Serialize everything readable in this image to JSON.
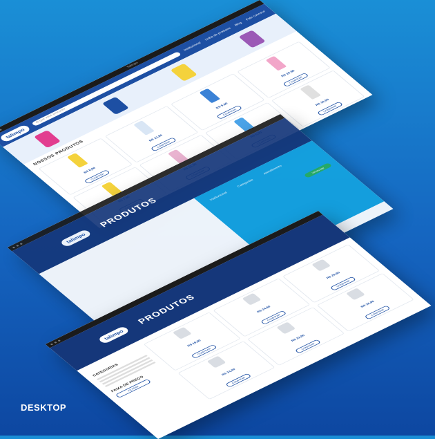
{
  "caption": "DESKTOP",
  "top_page": {
    "browser_title": "Talimpo",
    "logo": "talimpo",
    "search_placeholder": "O que você procura?",
    "nav": [
      "Institucional",
      "Linha de produtos",
      "Blog",
      "Fale conosco"
    ],
    "section_title": "NOSSOS PRODUTOS",
    "products": [
      {
        "price": "R$ 8,90",
        "cta": "COMPRAR",
        "color": "#f4d23c"
      },
      {
        "price": "R$ 12,90",
        "cta": "COMPRAR",
        "color": "#d9e6f5"
      },
      {
        "price": "R$ 9,90",
        "cta": "COMPRAR",
        "color": "#3b82d6"
      },
      {
        "price": "R$ 15,90",
        "cta": "COMPRAR",
        "color": "#f2a6c9"
      },
      {
        "price": "R$ 7,90",
        "cta": "COMPRAR",
        "color": "#f4d23c"
      },
      {
        "price": "R$ 11,90",
        "cta": "COMPRAR",
        "color": "#e9b3d0"
      },
      {
        "price": "R$ 6,90",
        "cta": "COMPRAR",
        "color": "#4aa3e8"
      },
      {
        "price": "R$ 10,90",
        "cta": "COMPRAR",
        "color": "#e0e0e0"
      }
    ],
    "hero_colors": [
      "#e23d8f",
      "#1d4fa3",
      "#f4d23c",
      "#9b59b6"
    ]
  },
  "middle_page": {
    "logo": "talimpo",
    "banner_title": "PRODUTOS",
    "footer_cols": [
      "Institucional",
      "Categorias",
      "Atendimento"
    ],
    "whatsapp_label": "WhatsApp"
  },
  "bottom_page": {
    "logo": "talimpo",
    "banner_title": "PRODUTOS",
    "sidebar_title": "CATEGORIAS",
    "filter_title": "FAIXA DE PREÇO",
    "filter_button": "FILTRAR",
    "products": [
      {
        "price": "R$ 19,90",
        "cta": "COMPRAR"
      },
      {
        "price": "R$ 24,90",
        "cta": "COMPRAR"
      },
      {
        "price": "R$ 29,90",
        "cta": "COMPRAR"
      },
      {
        "price": "R$ 14,90",
        "cta": "COMPRAR"
      },
      {
        "price": "R$ 22,90",
        "cta": "COMPRAR"
      },
      {
        "price": "R$ 18,90",
        "cta": "COMPRAR"
      }
    ]
  }
}
